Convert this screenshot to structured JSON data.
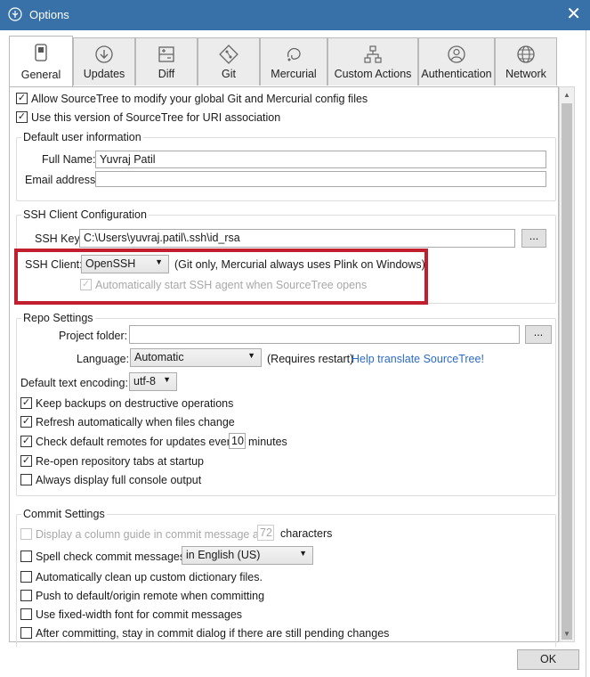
{
  "window": {
    "title": "Options",
    "close_label": "✕"
  },
  "tabs": [
    {
      "label": "General",
      "icon": "general-icon",
      "active": true
    },
    {
      "label": "Updates",
      "icon": "updates-icon"
    },
    {
      "label": "Diff",
      "icon": "diff-icon"
    },
    {
      "label": "Git",
      "icon": "git-icon"
    },
    {
      "label": "Mercurial",
      "icon": "mercurial-icon"
    },
    {
      "label": "Custom Actions",
      "icon": "custom-actions-icon"
    },
    {
      "label": "Authentication",
      "icon": "authentication-icon"
    },
    {
      "label": "Network",
      "icon": "network-icon"
    }
  ],
  "general": {
    "allow_modify_config": {
      "label": "Allow SourceTree to modify your global Git and Mercurial config files",
      "checked": true
    },
    "uri_association": {
      "label": "Use this version of SourceTree for URI association",
      "checked": true
    }
  },
  "user_info": {
    "title": "Default user information",
    "full_name_label": "Full Name:",
    "full_name_value": "Yuvraj Patil",
    "email_label": "Email address:",
    "email_value": ""
  },
  "ssh": {
    "title": "SSH Client Configuration",
    "key_label": "SSH Key:",
    "key_value": "C:\\Users\\yuvraj.patil\\.ssh\\id_rsa",
    "browse_label": "...",
    "client_label": "SSH Client:",
    "client_value": "OpenSSH",
    "client_note": "(Git only, Mercurial always uses Plink on Windows)",
    "auto_agent": {
      "label": "Automatically start SSH agent when SourceTree opens",
      "checked": true
    }
  },
  "repo": {
    "title": "Repo Settings",
    "project_folder_label": "Project folder:",
    "project_folder_value": "",
    "browse_label": "...",
    "language_label": "Language:",
    "language_value": "Automatic",
    "language_note": "(Requires restart)",
    "translate_link": "Help translate SourceTree!",
    "encoding_label": "Default text encoding:",
    "encoding_value": "utf-8",
    "keep_backups": {
      "label": "Keep backups on destructive operations",
      "checked": true
    },
    "refresh_auto": {
      "label": "Refresh automatically when files change",
      "checked": true
    },
    "check_remotes": {
      "label": "Check default remotes for updates every",
      "checked": true,
      "minutes": "10",
      "unit": "minutes"
    },
    "reopen_tabs": {
      "label": "Re-open repository tabs at startup",
      "checked": true
    },
    "full_console": {
      "label": "Always display full console output",
      "checked": false
    }
  },
  "commit": {
    "title": "Commit Settings",
    "column_guide": {
      "label": "Display a column guide in commit message at",
      "checked": false,
      "value": "72",
      "unit": "characters"
    },
    "spell_check": {
      "label": "Spell check commit messages",
      "checked": false,
      "language": "in English (US)"
    },
    "cleanup_dict": {
      "label": "Automatically clean up custom dictionary files.",
      "checked": false
    },
    "push_default": {
      "label": "Push to default/origin remote when committing",
      "checked": false
    },
    "fixed_width": {
      "label": "Use fixed-width font for commit messages",
      "checked": false
    },
    "stay_in_dialog": {
      "label": "After committing, stay in commit dialog if there are still pending changes",
      "checked": false
    }
  },
  "footer": {
    "ok_label": "OK"
  },
  "colors": {
    "titlebar": "#3771a8",
    "highlight": "#c21f2e",
    "link": "#2b6cc4"
  }
}
